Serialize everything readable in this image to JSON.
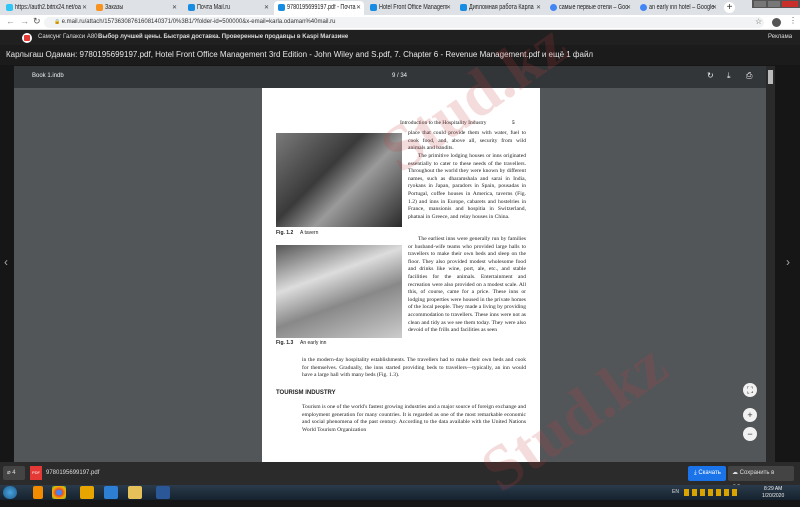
{
  "tabs": [
    {
      "label": "https://auth2.bitrix24.net/oa",
      "color": "#2fc6f6"
    },
    {
      "label": "Заказы",
      "color": "#f7931e"
    },
    {
      "label": "Почта Mail.ru",
      "color": "#168de2"
    },
    {
      "label": "9780195699197.pdf - Почта",
      "color": "#168de2",
      "active": true
    },
    {
      "label": "Hotel Front Office Managem",
      "color": "#168de2"
    },
    {
      "label": "Дипломная работа Карла",
      "color": "#168de2"
    },
    {
      "label": "самые первые отели – Goo",
      "color": "#4285f4"
    },
    {
      "label": "an early inn hotel – Google",
      "color": "#4285f4"
    }
  ],
  "address": {
    "url": "e.mail.ru/attach/15736308761608140371/0%3B1/?folder-id=500000&x-email=karla.odaman%40mail.ru"
  },
  "promo": {
    "brand": "Самсунг Галакси А80",
    "text": "Выбор лучшей цены. Быстрая доставка. Проверенные продавцы в Kaspi Магазине",
    "right": "Реклама"
  },
  "header_title": "Карлыгаш Одаман: 9780195699197.pdf, Hotel Front Office Management 3rd Edition - John Wiley and S.pdf, 7. Chapter 6 - Revenue Management.pdf и ещё 1 файл",
  "viewer": {
    "file": "Book 1.indb",
    "page_indicator": "9 / 34"
  },
  "page": {
    "running_head": "Introduction to the Hospitality Industry",
    "page_num": "5",
    "fig1_caption_num": "Fig. 1.2",
    "fig1_caption": "A tavern",
    "fig2_caption_num": "Fig. 1.3",
    "fig2_caption": "An early inn",
    "para1": "place that could provide them with water, fuel to cook food, and, above all, security from wild animals and bandits.",
    "para2": "The primitive lodging houses or inns originated essentially to cater to these needs of the travellers. Throughout the world they were known by different names, such as dharamshala and sarai in India, ryokans in Japan, paradors in Spain, pousadas in Portugal, coffee houses in America, taverns (Fig. 1.2) and inns in Europe, cabarets and hostelries in France, mansionis and hospitia in Switzerland, phatnai in Greece, and relay houses in China.",
    "para3": "The earliest inns were generally run by families or husband-wife teams who provided large halls to travellers to make their own beds and sleep on the floor. They also provided modest wholesome food and drinks like wine, port, ale, etc., and stable facilities for the animals. Entertainment and recreation were also provided on a modest scale. All this, of course, came for a price. These inns or lodging properties were housed in the private homes of the local people. They made a living by providing accommodation to travellers. These inns were not as clean and tidy as we see them today. They were also devoid of the frills and facilities as seen",
    "para3b": "in the modern-day hospitality establishments. The travellers had to make their own beds and cook for themselves. Gradually, the inns started providing beds to travellers—typically, an inn would have a large hall with many beds (Fig. 1.3).",
    "section_heading": "TOURISM INDUSTRY",
    "para4": "Tourism is one of the world's fastest growing industries and a major source of foreign exchange and employment generation for many countries. It is regarded as one of the most remarkable economic and social phenomena of the past century. According to the data available with the United Nations World Tourism Organization"
  },
  "bottom": {
    "count": "4",
    "pdf_badge": "PDF",
    "file": "9780195699197.pdf",
    "download": "Скачать",
    "save_cloud": "Сохранить в Облако"
  },
  "tray": {
    "lang": "EN",
    "time": "8:29 AM",
    "date": "1/20/2020"
  },
  "watermark": "Stud.kz"
}
